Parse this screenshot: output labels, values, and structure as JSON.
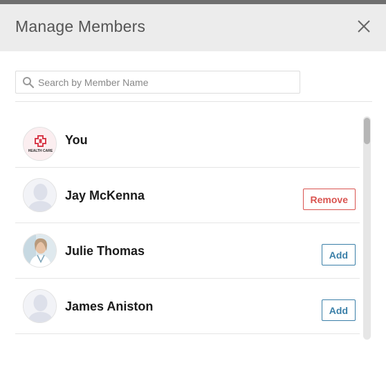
{
  "dialog": {
    "title": "Manage Members"
  },
  "search": {
    "placeholder": "Search by Member Name",
    "value": ""
  },
  "members": [
    {
      "name": "You",
      "avatar": "health-care-logo",
      "logo_text": "HEALTH CARE",
      "action": null
    },
    {
      "name": "Jay McKenna",
      "avatar": "default-avatar",
      "action": "Remove"
    },
    {
      "name": "Julie Thomas",
      "avatar": "photo-avatar",
      "action": "Add"
    },
    {
      "name": "James Aniston",
      "avatar": "default-avatar",
      "action": "Add"
    }
  ],
  "colors": {
    "remove": "#d9534f",
    "add": "#3a7fa8",
    "header_bg": "#ececec",
    "logo_red": "#d83a4a"
  }
}
